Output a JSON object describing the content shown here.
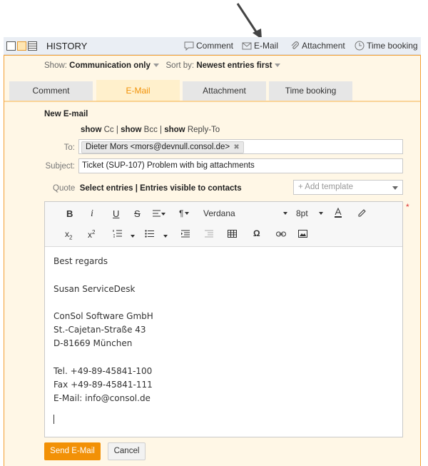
{
  "header": {
    "title": "HISTORY",
    "actions": [
      "Comment",
      "E-Mail",
      "Attachment",
      "Time booking"
    ]
  },
  "filter": {
    "show_label": "Show:",
    "show_value": "Communication only",
    "sort_label": "Sort by:",
    "sort_value": "Newest entries first"
  },
  "tabs": [
    {
      "label": "Comment",
      "active": false
    },
    {
      "label": "E-Mail",
      "active": true
    },
    {
      "label": "Attachment",
      "active": false
    },
    {
      "label": "Time booking",
      "active": false
    }
  ],
  "form": {
    "title": "New E-mail",
    "show_word": "show",
    "show_cc": "Cc",
    "show_bcc": "Bcc",
    "show_reply": "Reply-To",
    "sep": "|",
    "to_label": "To:",
    "to_value": "Dieter Mors <mors@devnull.consol.de>",
    "subject_label": "Subject:",
    "subject_value": "Ticket (SUP-107) Problem with big attachments",
    "quote_label": "Quote",
    "quote_select": "Select entries",
    "quote_visible": "Entries visible to contacts",
    "template_placeholder": "+ Add template",
    "required_mark": "*"
  },
  "toolbar": {
    "bold": "B",
    "italic": "i",
    "underline": "U",
    "strike": "S",
    "paragraph": "¶",
    "font": "Verdana",
    "size": "8pt",
    "subscript": "x",
    "subscript_sub": "2",
    "superscript": "x",
    "superscript_sup": "2",
    "special_char": "Ω"
  },
  "body": [
    "Best regards",
    "Susan ServiceDesk",
    "ConSol Software GmbH",
    "St.-Cajetan-Straße 43",
    "D-81669 München",
    "Tel. +49-89-45841-100",
    "Fax +49-89-45841-111",
    "E-Mail: info@consol.de"
  ],
  "buttons": {
    "send": "Send E-Mail",
    "cancel": "Cancel"
  },
  "colors": {
    "accent": "#f29106",
    "panel_border": "#f3a033",
    "panel_bg": "#fff7e6",
    "header_bg": "#eaeef4"
  }
}
